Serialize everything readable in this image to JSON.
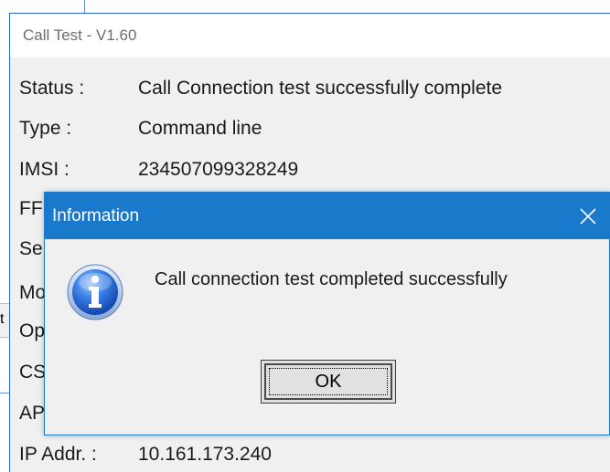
{
  "background_window": {
    "fragment_char": "t"
  },
  "main_window": {
    "title": "Call Test - V1.60",
    "rows": [
      {
        "label": "Status :",
        "value": "Call Connection test successfully complete"
      },
      {
        "label": "Type :",
        "value": "Command line"
      },
      {
        "label": "IMSI :",
        "value": "234507099328249"
      },
      {
        "label": "FF",
        "value": ""
      },
      {
        "label": "Se",
        "value": ""
      },
      {
        "label": "Mo",
        "value": ""
      },
      {
        "label": "Op",
        "value": ""
      },
      {
        "label": "CS",
        "value": ""
      },
      {
        "label": "AP",
        "value": ""
      },
      {
        "label": "IP Addr. :",
        "value": "10.161.173.240"
      }
    ]
  },
  "dialog": {
    "title": "Information",
    "close_icon": "close-icon",
    "info_icon": "info-icon",
    "message": "Call connection test completed successfully",
    "ok_label": "OK"
  },
  "colors": {
    "dialog_titlebar": "#1979ca",
    "window_border": "#2b64c8",
    "window_bg": "#f0f0f0"
  }
}
